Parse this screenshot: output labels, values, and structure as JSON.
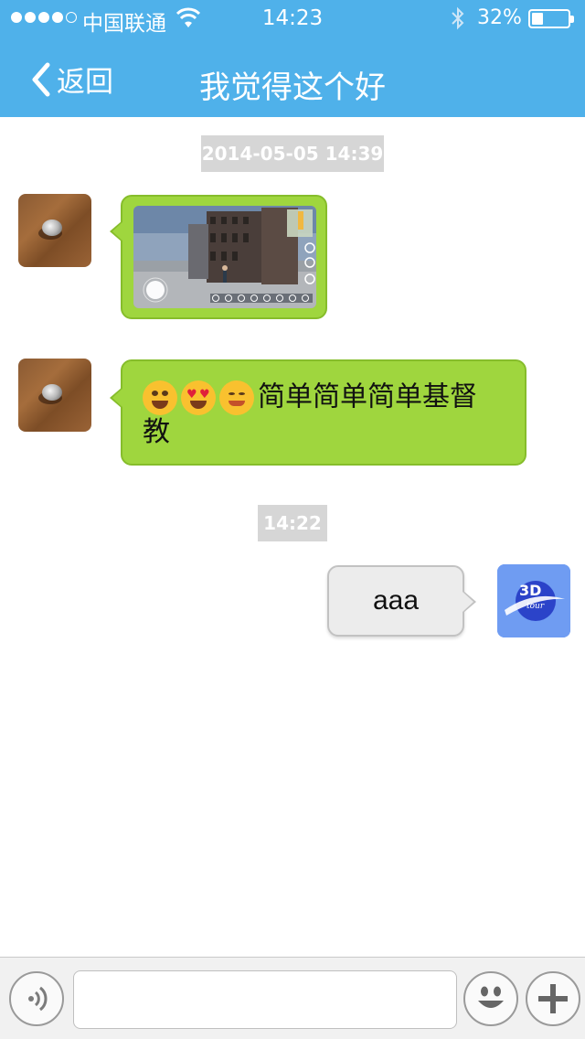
{
  "status_bar": {
    "carrier": "中国联通",
    "time": "14:23",
    "battery_percent": "32%",
    "battery_level": 0.32,
    "signal_bars": 4,
    "signal_total": 5
  },
  "nav": {
    "back_label": "返回",
    "title": "我觉得这个好"
  },
  "chat": {
    "timestamps": [
      "2014-05-05 14:39",
      "14:22"
    ],
    "messages": [
      {
        "side": "left",
        "type": "image",
        "icon": "street-view-screenshot"
      },
      {
        "side": "left",
        "type": "text",
        "emojis": [
          "grinning-face",
          "heart-eyes-face",
          "smiling-face"
        ],
        "text_line1": "简单简单简单基督",
        "text_line2": "教"
      },
      {
        "side": "right",
        "type": "text",
        "text": "aaa",
        "avatar_label": "3D",
        "avatar_sublabel": "tour"
      }
    ]
  },
  "input_bar": {
    "voice_icon": "voice-icon",
    "emoji_icon": "emoji-face-icon",
    "plus_icon": "plus-icon",
    "input_value": "",
    "input_placeholder": ""
  },
  "colors": {
    "header": "#4fb1ea",
    "bubble_incoming": "#9fd63e",
    "bubble_outgoing": "#ececec",
    "timestamp_bg": "#d6d6d6"
  }
}
